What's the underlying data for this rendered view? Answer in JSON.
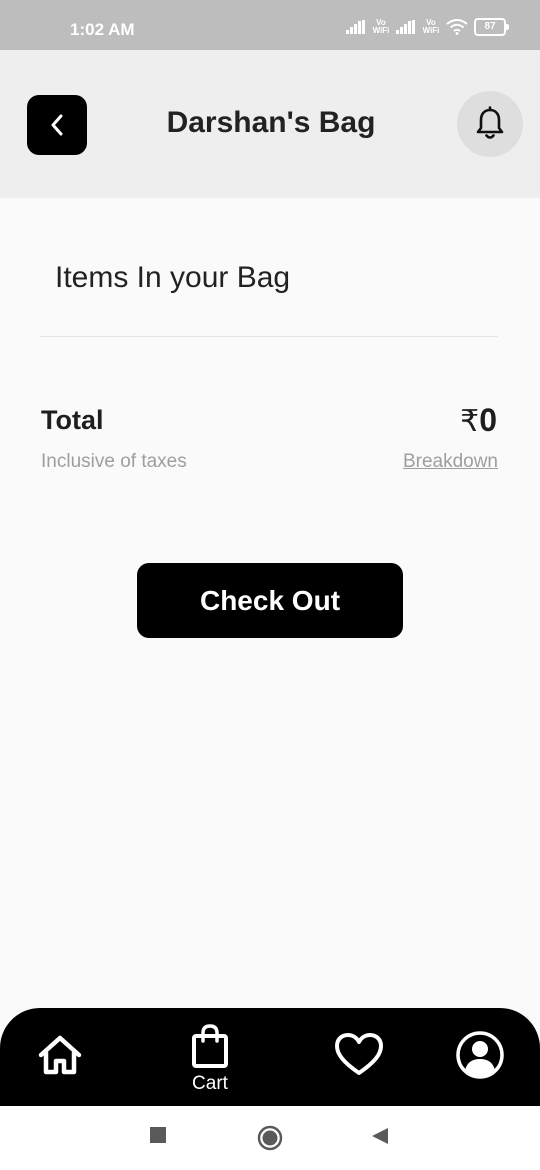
{
  "status_bar": {
    "time": "1:02 AM",
    "network_label_1": "Vo WiFi",
    "network_label_2": "Vo WiFi",
    "battery": "87"
  },
  "header": {
    "title": "Darshan's Bag",
    "back_icon": "chevron-left-icon",
    "bell_icon": "bell-icon"
  },
  "bag": {
    "section_title": "Items In your Bag",
    "total_label": "Total",
    "currency": "₹",
    "total_value": "0",
    "taxes_note": "Inclusive of taxes",
    "breakdown_label": "Breakdown",
    "checkout_label": "Check Out"
  },
  "bottom_nav": {
    "items": [
      {
        "icon": "home-icon",
        "label": ""
      },
      {
        "icon": "shopping-bag-icon",
        "label": "Cart"
      },
      {
        "icon": "heart-icon",
        "label": ""
      },
      {
        "icon": "user-icon",
        "label": ""
      }
    ]
  },
  "colors": {
    "accent": "#000000",
    "header_bg": "#eeeeee",
    "page_bg": "#fafafa",
    "muted_text": "#9e9e9e"
  }
}
